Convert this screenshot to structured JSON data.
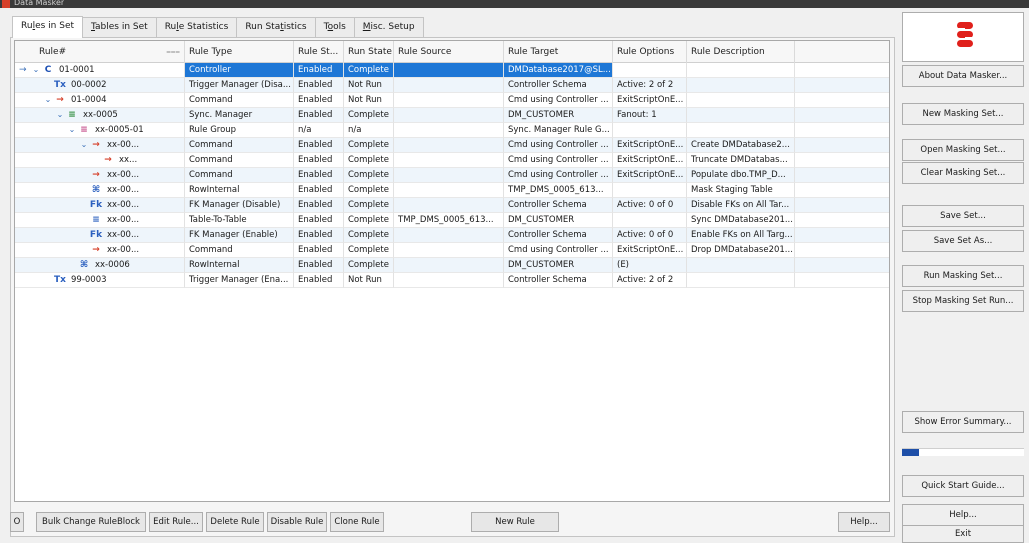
{
  "window": {
    "title": "Data Masker"
  },
  "tabs": [
    {
      "pre": "Ru",
      "u": "l",
      "post": "es in Set",
      "active": true
    },
    {
      "pre": "",
      "u": "T",
      "post": "ables in Set",
      "active": false
    },
    {
      "pre": "Ru",
      "u": "l",
      "post": "e Statistics",
      "active": false
    },
    {
      "pre": "Run Sta",
      "u": "t",
      "post": "istics",
      "active": false
    },
    {
      "pre": "T",
      "u": "o",
      "post": "ols",
      "active": false
    },
    {
      "pre": "",
      "u": "M",
      "post": "isc. Setup",
      "active": false
    }
  ],
  "grid": {
    "columns": [
      "Rule#",
      "Rule Type",
      "Rule St...",
      "Run State",
      "Rule Source",
      "Rule Target",
      "Rule Options",
      "Rule Description"
    ],
    "rows": [
      {
        "num": "01-0001",
        "type": "Controller",
        "status": "Enabled",
        "run": "Complete",
        "source": "",
        "target": "DMDatabase2017@SL...",
        "options": "",
        "desc": "",
        "icon": "C",
        "iconColor": "#1c4fb3",
        "level": 0,
        "chev": "v",
        "marker": "→"
      },
      {
        "num": "00-0002",
        "type": "Trigger Manager (Disa...",
        "status": "Enabled",
        "run": "Not Run",
        "source": "",
        "target": "Controller Schema",
        "options": "Active: 2 of 2",
        "desc": "",
        "icon": "Tx",
        "iconColor": "#2a5fbf",
        "level": 1,
        "chev": "",
        "marker": ""
      },
      {
        "num": "01-0004",
        "type": "Command",
        "status": "Enabled",
        "run": "Not Run",
        "source": "",
        "target": "Cmd using Controller ...",
        "options": "ExitScriptOnE...",
        "desc": "",
        "icon": "→",
        "iconColor": "#d6402a",
        "level": 1,
        "chev": "v",
        "marker": ""
      },
      {
        "num": "xx-0005",
        "type": "Sync. Manager",
        "status": "Enabled",
        "run": "Complete",
        "source": "",
        "target": "DM_CUSTOMER",
        "options": "Fanout: 1",
        "desc": "",
        "icon": "≡",
        "iconColor": "#2a8a3a",
        "level": 2,
        "chev": "v",
        "marker": ""
      },
      {
        "num": "xx-0005-01",
        "type": "Rule Group",
        "status": "n/a",
        "run": "n/a",
        "source": "",
        "target": "Sync. Manager Rule G...",
        "options": "",
        "desc": "",
        "icon": "≡",
        "iconColor": "#c44c8a",
        "level": 3,
        "chev": "v",
        "marker": ""
      },
      {
        "num": "xx-00...",
        "type": "Command",
        "status": "Enabled",
        "run": "Complete",
        "source": "",
        "target": "Cmd using Controller ...",
        "options": "ExitScriptOnE...",
        "desc": "Create DMDatabase2...",
        "icon": "→",
        "iconColor": "#d6402a",
        "level": 4,
        "chev": "v",
        "marker": ""
      },
      {
        "num": "xx...",
        "type": "Command",
        "status": "Enabled",
        "run": "Complete",
        "source": "",
        "target": "Cmd using Controller ...",
        "options": "ExitScriptOnE...",
        "desc": "Truncate DMDatabas...",
        "icon": "→",
        "iconColor": "#d6402a",
        "level": 5,
        "chev": "",
        "marker": ""
      },
      {
        "num": "xx-00...",
        "type": "Command",
        "status": "Enabled",
        "run": "Complete",
        "source": "",
        "target": "Cmd using Controller ...",
        "options": "ExitScriptOnE...",
        "desc": "Populate dbo.TMP_D...",
        "icon": "→",
        "iconColor": "#d6402a",
        "level": 4,
        "chev": "",
        "marker": ""
      },
      {
        "num": "xx-00...",
        "type": "RowInternal",
        "status": "Enabled",
        "run": "Complete",
        "source": "",
        "target": "TMP_DMS_0005_613...",
        "options": "",
        "desc": "Mask Staging Table",
        "icon": "⌘",
        "iconColor": "#2a5fbf",
        "level": 4,
        "chev": "",
        "marker": ""
      },
      {
        "num": "xx-00...",
        "type": "FK Manager (Disable)",
        "status": "Enabled",
        "run": "Complete",
        "source": "",
        "target": "Controller Schema",
        "options": "Active: 0 of 0",
        "desc": "Disable FKs on All Tar...",
        "icon": "Fk",
        "iconColor": "#2a5fbf",
        "level": 4,
        "chev": "",
        "marker": ""
      },
      {
        "num": "xx-00...",
        "type": "Table-To-Table",
        "status": "Enabled",
        "run": "Complete",
        "source": "TMP_DMS_0005_613...",
        "target": "DM_CUSTOMER",
        "options": "",
        "desc": "Sync DMDatabase201...",
        "icon": "≡",
        "iconColor": "#2a5fbf",
        "level": 4,
        "chev": "",
        "marker": ""
      },
      {
        "num": "xx-00...",
        "type": "FK Manager (Enable)",
        "status": "Enabled",
        "run": "Complete",
        "source": "",
        "target": "Controller Schema",
        "options": "Active: 0 of 0",
        "desc": "Enable FKs on All Targ...",
        "icon": "Fk",
        "iconColor": "#2a5fbf",
        "level": 4,
        "chev": "",
        "marker": ""
      },
      {
        "num": "xx-00...",
        "type": "Command",
        "status": "Enabled",
        "run": "Complete",
        "source": "",
        "target": "Cmd using Controller ...",
        "options": "ExitScriptOnE...",
        "desc": "Drop DMDatabase201...",
        "icon": "→",
        "iconColor": "#d6402a",
        "level": 4,
        "chev": "",
        "marker": ""
      },
      {
        "num": "xx-0006",
        "type": "RowInternal",
        "status": "Enabled",
        "run": "Complete",
        "source": "",
        "target": "DM_CUSTOMER",
        "options": "(E)",
        "desc": "",
        "icon": "⌘",
        "iconColor": "#2a5fbf",
        "level": 3,
        "chev": "",
        "marker": ""
      },
      {
        "num": "99-0003",
        "type": "Trigger Manager (Ena...",
        "status": "Enabled",
        "run": "Not Run",
        "source": "",
        "target": "Controller Schema",
        "options": "Active: 2 of 2",
        "desc": "",
        "icon": "Tx",
        "iconColor": "#2a5fbf",
        "level": 1,
        "chev": "",
        "marker": ""
      }
    ]
  },
  "toolbar": {
    "o_button": "O",
    "bulk_change": "Bulk Change RuleBlock",
    "edit_rule": "Edit Rule...",
    "delete_rule": "Delete Rule",
    "disable_rule": "Disable Rule",
    "clone_rule": "Clone Rule",
    "new_rule": "New Rule",
    "help": "Help..."
  },
  "sidebar": {
    "about": "About Data Masker...",
    "new_set": "New Masking Set...",
    "open_set": "Open Masking Set...",
    "clear_set": "Clear Masking Set...",
    "save_set": "Save Set...",
    "save_set_as": "Save Set As...",
    "run_set": "Run Masking Set...",
    "stop_run": "Stop Masking Set Run...",
    "error_summary": "Show Error Summary...",
    "progress": 0.14,
    "quick_start": "Quick Start Guide...",
    "help": "Help...",
    "exit": "Exit"
  },
  "colors": {
    "selection": "#1e77d6",
    "logo_red": "#e0201b",
    "progress_fill": "#1e4fa8"
  }
}
